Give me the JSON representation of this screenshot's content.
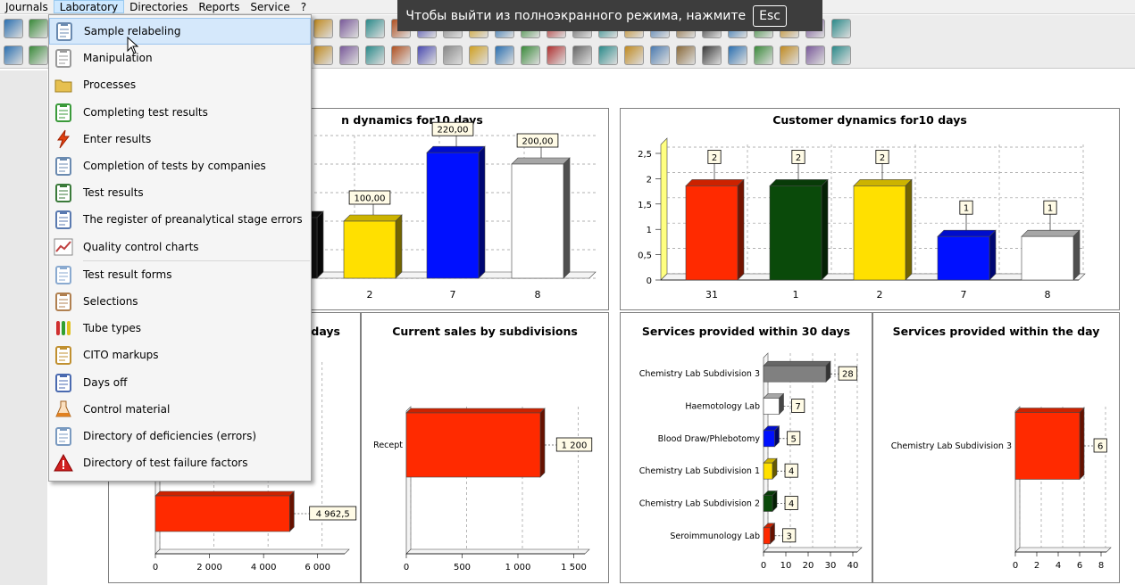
{
  "menubar": {
    "items": [
      "Journals",
      "Laboratory",
      "Directories",
      "Reports",
      "Service",
      "?"
    ],
    "active": "Laboratory"
  },
  "fullscreen_banner": {
    "text": "Чтобы выйти из полноэкранного режима, нажмите",
    "key": "Esc"
  },
  "dropdown": {
    "items": [
      {
        "label": "Sample relabeling",
        "icon": "clipboard-icon",
        "highlighted": true
      },
      {
        "label": "Manipulation",
        "icon": "syringe-icon"
      },
      {
        "label": "Processes",
        "icon": "folder-icon"
      },
      {
        "label": "Completing test results",
        "icon": "clipboard-plus-icon"
      },
      {
        "label": "Enter results",
        "icon": "lightning-icon"
      },
      {
        "label": "Completion of tests by companies",
        "icon": "clipboard-list-icon"
      },
      {
        "label": "Test results",
        "icon": "clipboard-check-icon"
      },
      {
        "label": "The register of preanalytical stage errors",
        "icon": "register-icon"
      },
      {
        "label": "Quality control charts",
        "icon": "line-chart-icon"
      },
      {
        "label": "Test result forms",
        "icon": "form-icon"
      },
      {
        "label": "Selections",
        "icon": "box-icon"
      },
      {
        "label": "Tube types",
        "icon": "tubes-icon"
      },
      {
        "label": "CITO markups",
        "icon": "check-list-icon"
      },
      {
        "label": "Days off",
        "icon": "calendar-icon"
      },
      {
        "label": "Control material",
        "icon": "flask-icon"
      },
      {
        "label": "Directory of deficiencies (errors)",
        "icon": "pencil-note-icon"
      },
      {
        "label": "Directory of test failure factors",
        "icon": "warning-icon"
      }
    ]
  },
  "colors": {
    "red": "#ff2a00",
    "green": "#0a4a0a",
    "yellow": "#ffe000",
    "blue": "#0010ff",
    "white": "#ffffff",
    "gray": "#808080",
    "black": "#111111"
  },
  "panels": {
    "sales_dynamics_title": "n dynamics for10 days",
    "customer_dynamics_title": "Customer dynamics for10 days",
    "left_bottom_title": "days",
    "current_sales_title": "Current sales by subdivisions",
    "services30_title": "Services provided within 30 days",
    "services_day_title": "Services provided within the day"
  },
  "chart_data": [
    {
      "type": "bar",
      "title": "n dynamics for10 days",
      "categories": [
        "2",
        "7",
        "8"
      ],
      "values": [
        100.0,
        220.0,
        200.0
      ],
      "labels": [
        "100,00",
        "220,00",
        "200,00"
      ],
      "colors": [
        "#ffe000",
        "#0010ff",
        "#ffffff"
      ],
      "partially_hidden_first_bar_color": "#111111"
    },
    {
      "type": "bar",
      "title": "Customer dynamics for10 days",
      "categories": [
        "31",
        "1",
        "2",
        "7",
        "8"
      ],
      "values": [
        2,
        2,
        2,
        1,
        1
      ],
      "colors": [
        "#ff2a00",
        "#0a4a0a",
        "#ffe000",
        "#0010ff",
        "#ffffff"
      ],
      "yticks": [
        "0",
        "0,5",
        "1",
        "1,5",
        "2",
        "2,5"
      ],
      "ylim": [
        0,
        2.5
      ]
    },
    {
      "type": "bar",
      "orientation": "horizontal",
      "title": "days",
      "values": [
        4962.5
      ],
      "labels": [
        "4 962,5"
      ],
      "xticks": [
        "0",
        "2 000",
        "4 000",
        "6 000"
      ],
      "xlim": [
        0,
        7000
      ],
      "colors": [
        "#ff2a00"
      ]
    },
    {
      "type": "bar",
      "orientation": "horizontal",
      "title": "Current sales by subdivisions",
      "categories": [
        "Recept"
      ],
      "values": [
        1200
      ],
      "labels": [
        "1 200"
      ],
      "xticks": [
        "0",
        "500",
        "1 000",
        "1 500"
      ],
      "xlim": [
        0,
        1600
      ],
      "colors": [
        "#ff2a00"
      ]
    },
    {
      "type": "bar",
      "orientation": "horizontal",
      "title": "Services provided within 30 days",
      "categories": [
        "Chemistry Lab Subdivision 3",
        "Haemotology Lab",
        "Blood Draw/Phlebotomy",
        "Chemistry Lab Subdivision 1",
        "Chemistry Lab Subdivision 2",
        "Seroimmunology Lab"
      ],
      "values": [
        28,
        7,
        5,
        4,
        4,
        3
      ],
      "colors": [
        "#808080",
        "#ffffff",
        "#0010ff",
        "#ffe000",
        "#0a4a0a",
        "#ff2a00"
      ],
      "xticks": [
        "0",
        "10",
        "20",
        "30",
        "40"
      ],
      "xlim": [
        0,
        42
      ]
    },
    {
      "type": "bar",
      "orientation": "horizontal",
      "title": "Services provided within the day",
      "categories": [
        "Chemistry Lab Subdivision 3"
      ],
      "values": [
        6
      ],
      "colors": [
        "#ff2a00"
      ],
      "xticks": [
        "0",
        "2",
        "4",
        "6",
        "8"
      ],
      "xlim": [
        0,
        8.5
      ]
    }
  ]
}
